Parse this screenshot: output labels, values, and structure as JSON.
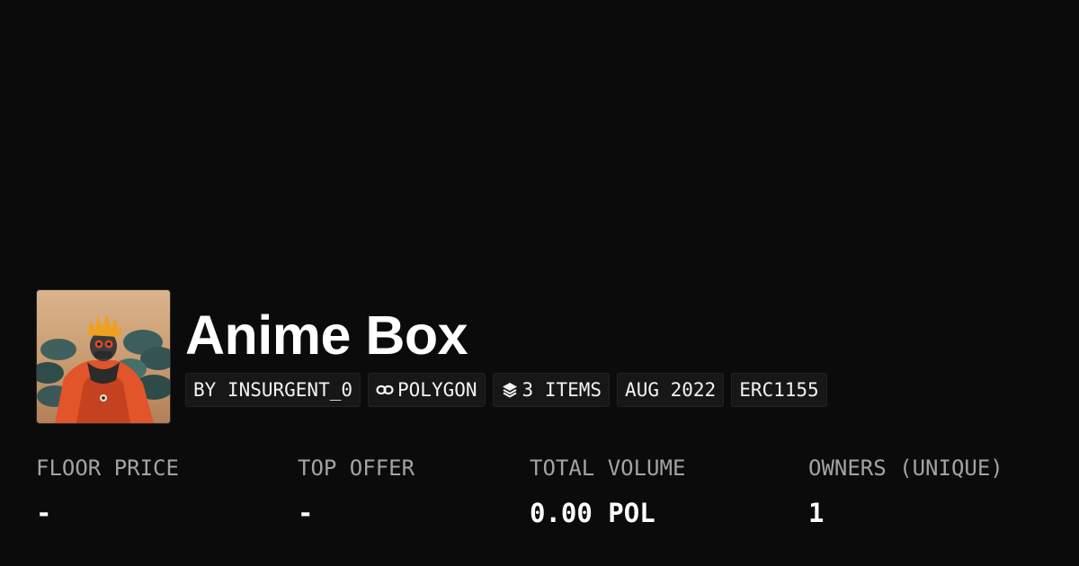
{
  "collection": {
    "title": "Anime Box",
    "thumbnail_icon": "anime-character-avatar"
  },
  "tags": {
    "creator": "BY INSURGENT_0",
    "chain": "POLYGON",
    "chain_icon": "polygon-link-icon",
    "items": "3 ITEMS",
    "items_icon": "layers-icon",
    "date": "AUG 2022",
    "standard": "ERC1155"
  },
  "stats": {
    "floor_price": {
      "label": "FLOOR PRICE",
      "value": "-"
    },
    "top_offer": {
      "label": "TOP OFFER",
      "value": "-"
    },
    "total_volume": {
      "label": "TOTAL VOLUME",
      "value": "0.00 POL"
    },
    "owners": {
      "label": "OWNERS (UNIQUE)",
      "value": "1"
    }
  },
  "colors": {
    "background": "#0b0b0b",
    "tag_background": "#171717",
    "label_gray": "#a3a3a3",
    "accent_orange": "#e8552a"
  }
}
